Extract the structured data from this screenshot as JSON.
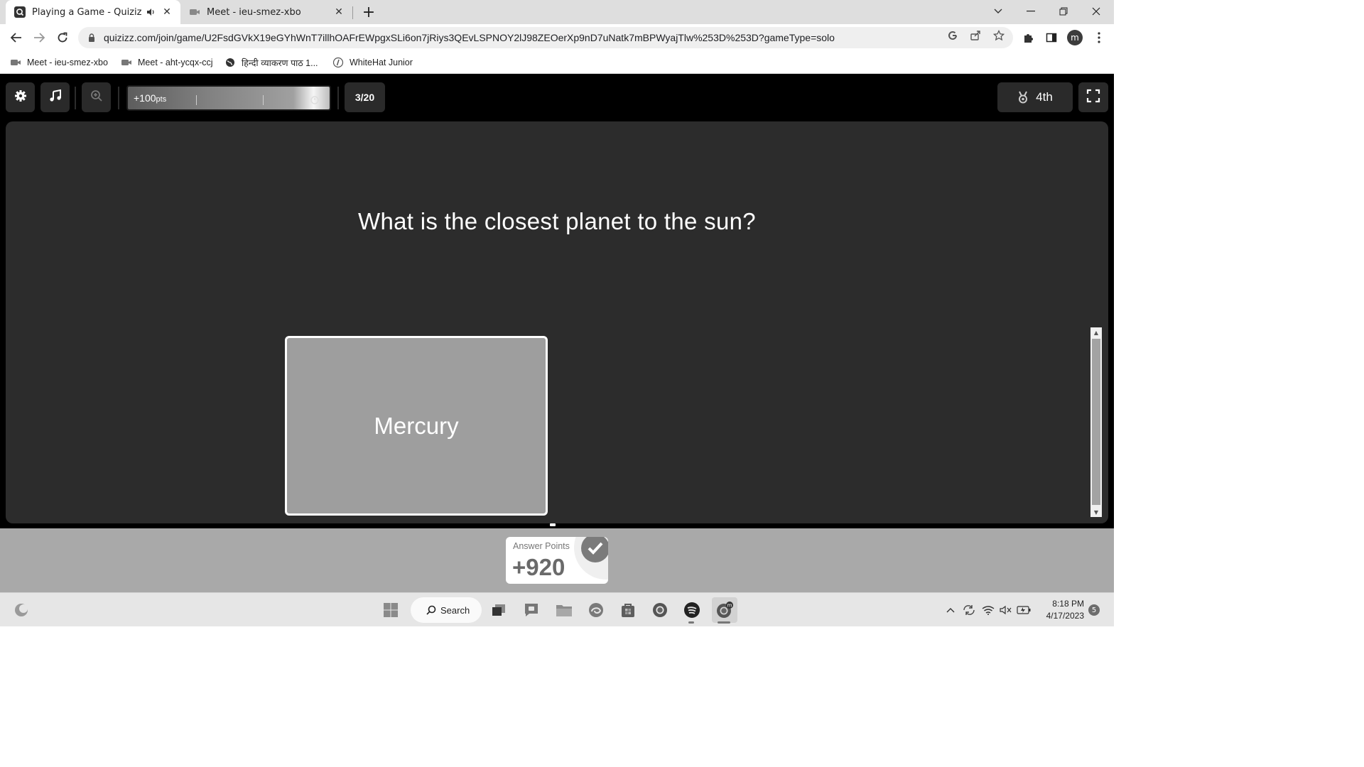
{
  "browser": {
    "tabs": [
      {
        "title": "Playing a Game - Quizizz",
        "active": true,
        "favicon": "quizizz-icon",
        "audio_icon": "speaker-icon"
      },
      {
        "title": "Meet - ieu-smez-xbo",
        "active": false,
        "favicon": "video-camera-icon"
      }
    ],
    "url": "quizizz.com/join/game/U2FsdGVkX19eGYhWnT7illhOAFrEWpgxSLi6on7jRiys3QEvLSPNOY2lJ98ZEOerXp9nD7uNatk7mBPWyajTlw%253D%253D?gameType=solo",
    "profile_initial": "m",
    "bookmarks": [
      {
        "label": "Meet - ieu-smez-xbo",
        "icon": "video-camera-icon"
      },
      {
        "label": "Meet - aht-ycqx-ccj",
        "icon": "video-camera-icon"
      },
      {
        "label": "हिन्दी व्याकरण पाठ 1...",
        "icon": "globe-icon"
      },
      {
        "label": "WhiteHat Junior",
        "icon": "whitehat-icon"
      }
    ]
  },
  "game": {
    "points_bonus": "+100",
    "points_unit": "pts",
    "question_counter": "3/20",
    "rank": "4th",
    "question": "What is the closest planet to the sun?",
    "options": [
      "Mercury"
    ],
    "answer_points_label": "Answer Points",
    "answer_points_value": "+920"
  },
  "taskbar": {
    "search_label": "Search",
    "time": "8:18 PM",
    "date": "4/17/2023",
    "notification_count": "5"
  },
  "colors": {
    "game_bg": "#000000",
    "panel_bg": "#2c2c2c",
    "option_bg": "#9e9e9e",
    "footer_bg": "#a9a9a9"
  }
}
